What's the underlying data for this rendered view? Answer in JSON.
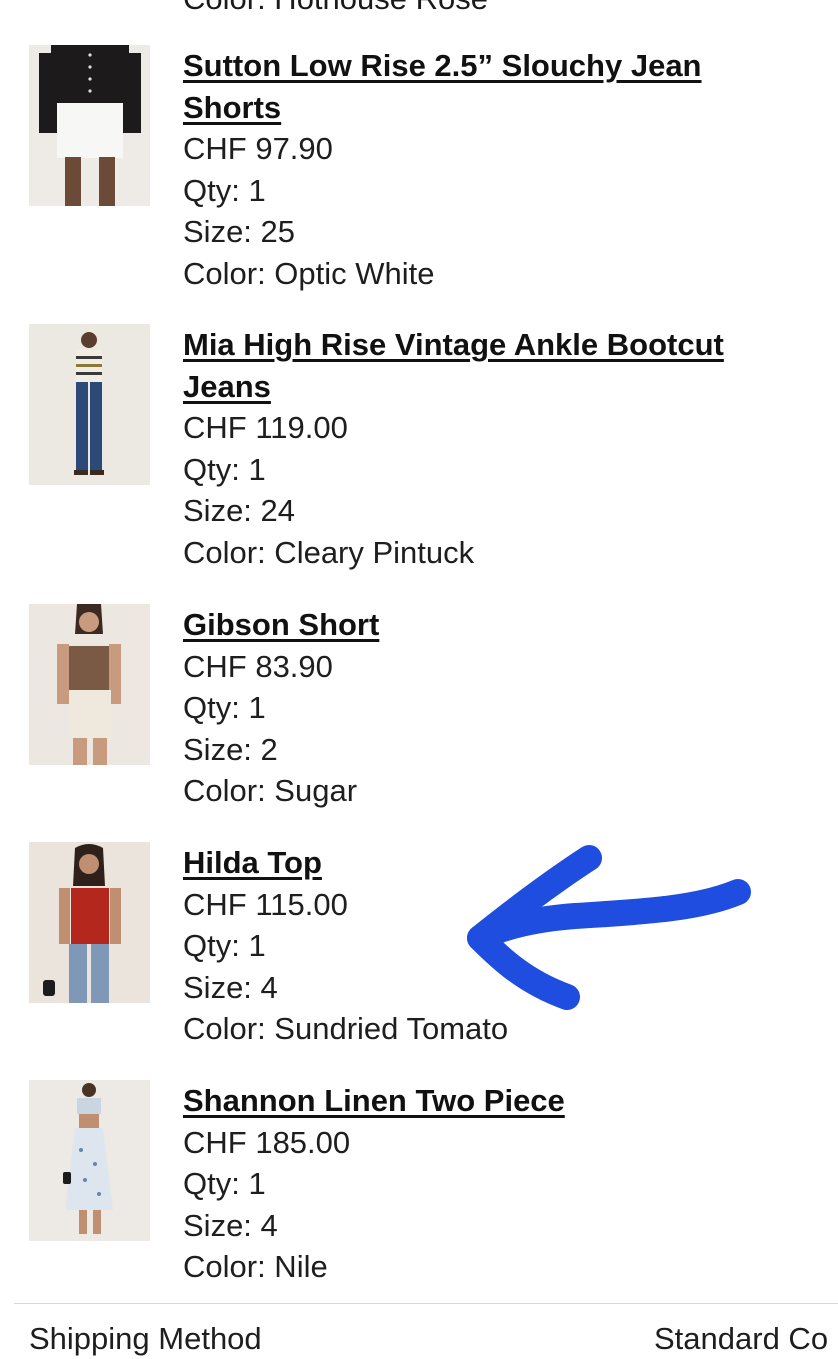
{
  "clipped_previous_item": {
    "color_line": "Color: Hothouse Rose"
  },
  "items": [
    {
      "title": "Sutton Low Rise 2.5” Slouchy Jean Shorts",
      "price": "CHF 97.90",
      "qty": "Qty: 1",
      "size": "Size: 25",
      "color": "Color: Optic White",
      "image": "product-thumbnail-sutton-shorts"
    },
    {
      "title": "Mia High Rise Vintage Ankle Bootcut Jeans",
      "price": "CHF 119.00",
      "qty": "Qty: 1",
      "size": "Size: 24",
      "color": "Color: Cleary Pintuck",
      "image": "product-thumbnail-mia-jeans"
    },
    {
      "title": "Gibson Short",
      "price": "CHF 83.90",
      "qty": "Qty: 1",
      "size": "Size: 2",
      "color": "Color: Sugar",
      "image": "product-thumbnail-gibson-short"
    },
    {
      "title": "Hilda Top",
      "price": "CHF 115.00",
      "qty": "Qty: 1",
      "size": "Size: 4",
      "color": "Color: Sundried Tomato",
      "image": "product-thumbnail-hilda-top"
    },
    {
      "title": "Shannon Linen Two Piece",
      "price": "CHF 185.00",
      "qty": "Qty: 1",
      "size": "Size: 4",
      "color": "Color: Nile",
      "image": "product-thumbnail-shannon-two-piece"
    }
  ],
  "shipping": {
    "label": "Shipping Method",
    "value": "Standard Co"
  },
  "annotation": {
    "icon": "hand-drawn-arrow-icon",
    "color": "#1f4de0"
  },
  "colors": {
    "text": "#1e1e1e",
    "title": "#111111",
    "divider": "#d8d8d8"
  }
}
